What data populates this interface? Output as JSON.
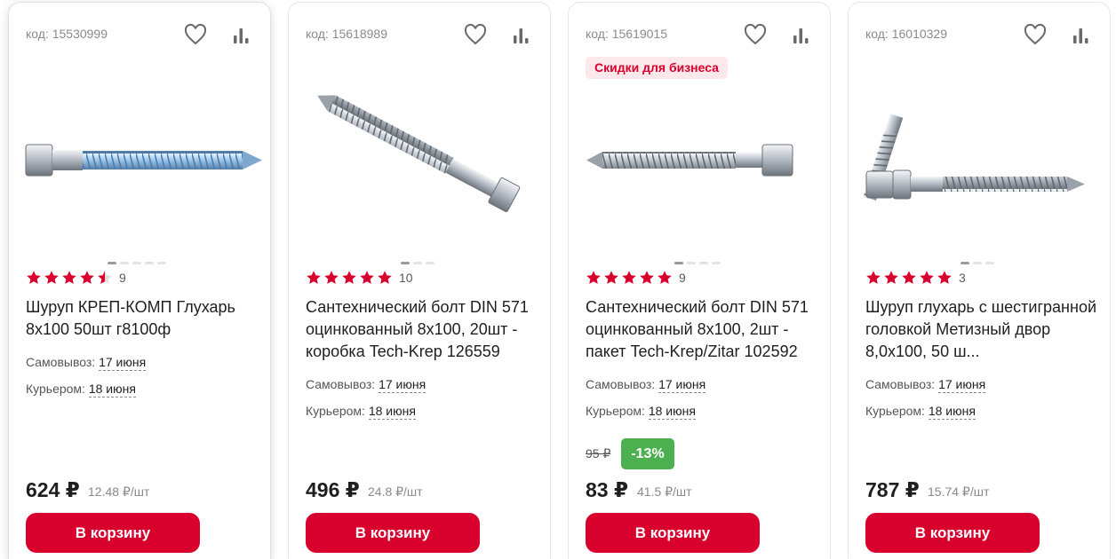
{
  "colors": {
    "accent": "#d8002c",
    "star": "#d8002c",
    "discount": "#4caf50",
    "promo_bg": "#fde8eb"
  },
  "products": [
    {
      "code": "код: 15530999",
      "rating": 4.5,
      "rating_count": "9",
      "title": "Шуруп КРЕП-КОМП Глухарь 8х100 50шт г8100ф",
      "pickup_label": "Самовывоз:",
      "pickup_date": "17 июня",
      "courier_label": "Курьером:",
      "courier_date": "18 июня",
      "price": "624 ₽",
      "unit_price": "12.48 ₽/шт",
      "cart_label": "В корзину",
      "image_count": 5,
      "image_active": 1
    },
    {
      "code": "код: 15618989",
      "rating": 5,
      "rating_count": "10",
      "title": "Сантехнический болт DIN 571 оцинкованный 8х100, 20шт - коробка Tech-Krep 126559",
      "pickup_label": "Самовывоз:",
      "pickup_date": "17 июня",
      "courier_label": "Курьером:",
      "courier_date": "18 июня",
      "price": "496 ₽",
      "unit_price": "24.8 ₽/шт",
      "cart_label": "В корзину",
      "image_count": 3,
      "image_active": 1
    },
    {
      "code": "код: 15619015",
      "promo": "Скидки для бизнеса",
      "rating": 5,
      "rating_count": "9",
      "title": "Сантехнический болт DIN 571 оцинкованный 8х100, 2шт - пакет Tech-Krep/Zitar 102592",
      "pickup_label": "Самовывоз:",
      "pickup_date": "17 июня",
      "courier_label": "Курьером:",
      "courier_date": "18 июня",
      "old_price": "95 ₽",
      "discount": "-13%",
      "price": "83 ₽",
      "unit_price": "41.5 ₽/шт",
      "cart_label": "В корзину",
      "image_count": 4,
      "image_active": 1
    },
    {
      "code": "код: 16010329",
      "rating": 5,
      "rating_count": "3",
      "title": "Шуруп глухарь с шестигранной головкой Метизный двор 8,0х100, 50 ш...",
      "pickup_label": "Самовывоз:",
      "pickup_date": "17 июня",
      "courier_label": "Курьером:",
      "courier_date": "18 июня",
      "price": "787 ₽",
      "unit_price": "15.74 ₽/шт",
      "cart_label": "В корзину",
      "image_count": 3,
      "image_active": 1
    }
  ]
}
